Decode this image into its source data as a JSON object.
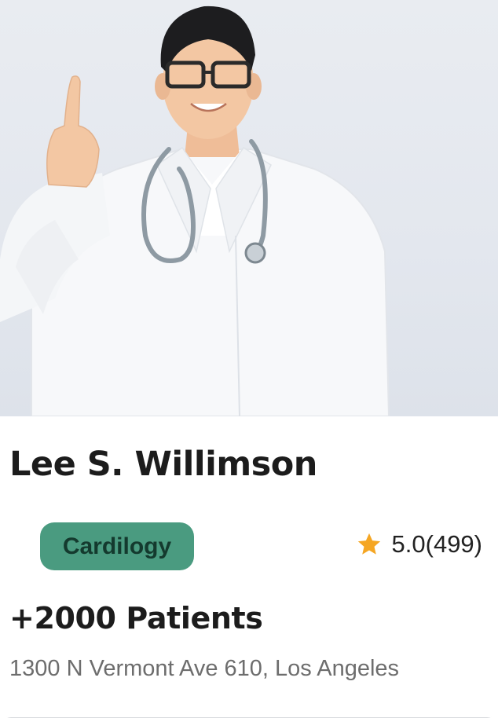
{
  "doctor": {
    "name": "Lee S. Willimson",
    "specialty": "Cardilogy",
    "rating": "5.0(499)",
    "patients": "+2000 Patients",
    "address": "1300 N Vermont Ave 610, Los Angeles"
  },
  "icons": {
    "rating": "star-icon",
    "photo": "doctor-photo"
  },
  "colors": {
    "badge_bg": "#4a9b80",
    "badge_text": "#143a2e",
    "star": "#f5a623",
    "name_text": "#1c1c1c",
    "address_text": "#6d6d6d"
  }
}
